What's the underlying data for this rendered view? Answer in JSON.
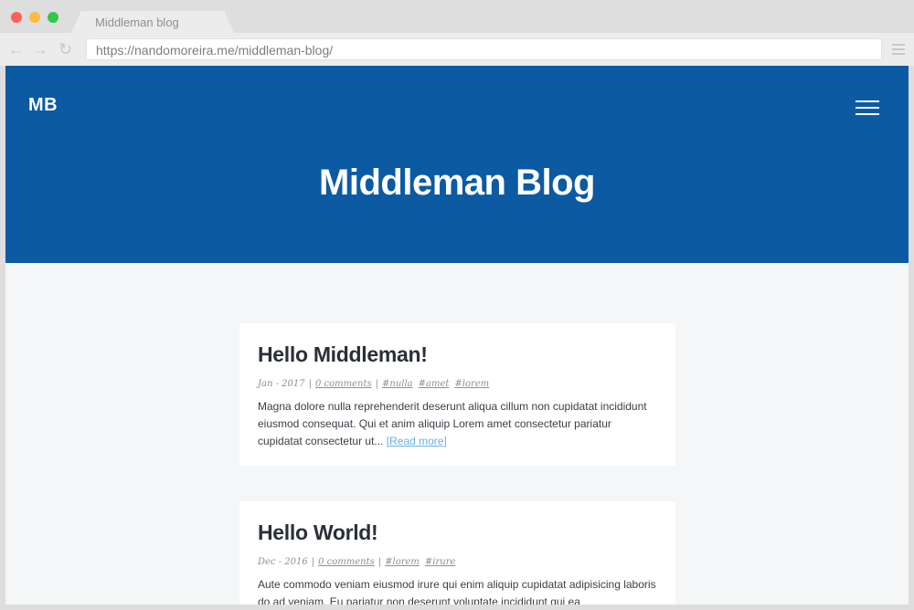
{
  "browser": {
    "tab_title": "Middleman blog",
    "url": "https://nandomoreira.me/middleman-blog/",
    "nav_back": "←",
    "nav_forward": "→",
    "nav_reload": "↻"
  },
  "site": {
    "logo": "MB",
    "title": "Middleman Blog"
  },
  "posts": [
    {
      "title": "Hello Middleman!",
      "date": "Jan - 2017",
      "comments": "0 comments",
      "tags": [
        "#nulla",
        "#amet",
        "#lorem"
      ],
      "excerpt": "Magna dolore nulla reprehenderit deserunt aliqua cillum non cupidatat incididunt eiusmod consequat. Qui et anim aliquip Lorem amet consectetur pariatur cupidatat consectetur ut...",
      "read_more": "[Read more]"
    },
    {
      "title": "Hello World!",
      "date": "Dec - 2016",
      "comments": "0 comments",
      "tags": [
        "#lorem",
        "#irure"
      ],
      "excerpt": "Aute commodo veniam eiusmod irure qui enim aliquip cupidatat adipisicing laboris do ad veniam. Eu pariatur non deserunt voluptate incididunt qui ea"
    }
  ],
  "colors": {
    "hero": "#0c5aa2",
    "background": "#f5f6f7",
    "link": "#6ab0e0"
  }
}
